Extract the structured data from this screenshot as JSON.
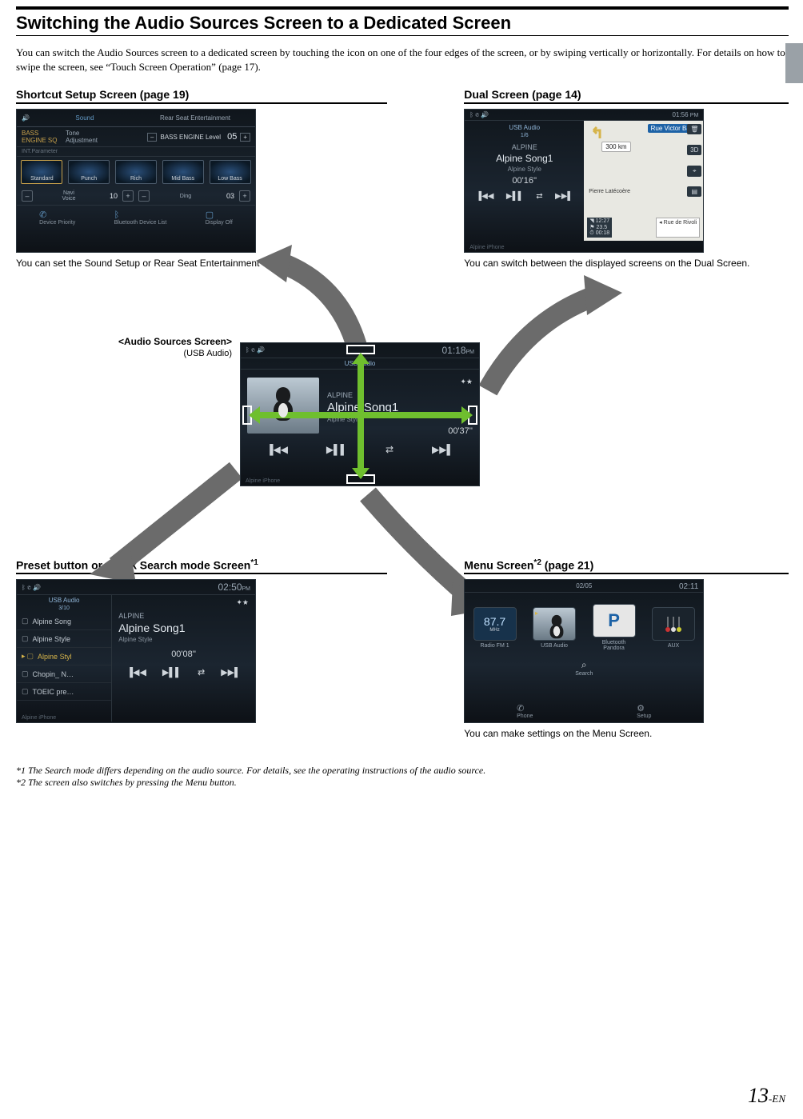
{
  "title": "Switching the Audio Sources Screen to a Dedicated Screen",
  "intro": "You can switch the Audio Sources screen to a dedicated screen by touching the icon on one of the four edges of the screen, or by swiping vertically or horizontally. For details on how to swipe the screen, see “Touch Screen Operation” (page 17).",
  "sections": {
    "shortcut": {
      "heading": "Shortcut Setup Screen (page 19)",
      "caption": "You can set the Sound Setup or Rear Seat Entertainment System.",
      "tabs": {
        "sound": "Sound",
        "rse": "Rear Seat Entertainment"
      },
      "labels": {
        "bass_sq": "BASS\nENGINE SQ",
        "tone": "Tone\nAdjustment",
        "bass_level": "BASS ENGINE Level",
        "int_param": "INT.Parameter"
      },
      "eq_options": [
        "Standard",
        "Punch",
        "Rich",
        "Mid Bass",
        "Low Bass"
      ],
      "row_a": {
        "left_icon": "Navi\nVoice",
        "left_val": "10",
        "right_icon": "Ding",
        "right_val": "03"
      },
      "bass_val": "05",
      "bottom": [
        "Device Priority",
        "Bluetooth Device List",
        "Display Off"
      ]
    },
    "dual": {
      "heading": "Dual Screen (page 14)",
      "caption": "You can switch between the displayed screens on the Dual Screen.",
      "time": "01:56",
      "ampm": "PM",
      "usb": "USB Audio",
      "track": "1/6",
      "artist": "ALPINE",
      "song": "Alpine Song1",
      "album": "Alpine Style",
      "elapsed": "00'16''",
      "map": {
        "street1": "Rue Victor Balta",
        "dist": "300 km",
        "poi": "Pierre Latécoère",
        "street2": "Rue de Rivoli",
        "t1": "12:27",
        "t2": "23.5",
        "t3": "00:18",
        "btn3d": "3D"
      },
      "footer": "Alpine iPhone"
    },
    "center": {
      "label": "<Audio Sources Screen>",
      "sublabel": "(USB Audio)",
      "time": "01:18",
      "ampm": "PM",
      "usb": "USB Audio",
      "artist": "ALPINE",
      "song": "Alpine Song1",
      "album": "Alpine Style",
      "elapsed": "00'37''",
      "footer": "Alpine iPhone"
    },
    "preset": {
      "heading": "Preset button or Quick Search mode Screen",
      "sup": "*1",
      "time": "02:50",
      "ampm": "PM",
      "usb": "USB Audio",
      "track": "3/10",
      "list": [
        "Alpine Song",
        "Alpine Style",
        "Alpine Styl",
        "Chopin_ N…",
        "TOEIC pre…"
      ],
      "artist": "ALPINE",
      "song": "Alpine Song1",
      "album": "Alpine Style",
      "elapsed": "00'08''",
      "footer": "Alpine iPhone"
    },
    "menu": {
      "heading": "Menu Screen",
      "sup": "*2",
      "heading_page": " (page 21)",
      "caption": "You can make settings on the Menu Screen.",
      "date": "02/05",
      "time": "02:11",
      "cards": [
        {
          "label": "Radio FM 1",
          "val": "87.7",
          "unit": "MHz"
        },
        {
          "label": "USB Audio"
        },
        {
          "label": "Bluetooth\nPandora"
        },
        {
          "label": "AUX"
        }
      ],
      "search": "Search",
      "foot": [
        "Phone",
        "Setup"
      ]
    }
  },
  "footnotes": {
    "f1": "*1 The Search mode differs depending on the audio source. For details, see the operating instructions of the audio source.",
    "f2": "*2 The screen also switches by pressing the Menu button."
  },
  "page_no_big": "13",
  "page_no_sm": "-EN",
  "icons": {
    "prev": "▐◀◀",
    "playpause": "▶▌▌",
    "next": "▶▶▌",
    "fav": "✦★",
    "minus": "–",
    "plus": "+",
    "bt": "ᛒ",
    "phone": "✆",
    "gear": "⚙",
    "search": "⌕",
    "trash": "🗑",
    "mix": "⇄",
    "pin": "◥"
  }
}
